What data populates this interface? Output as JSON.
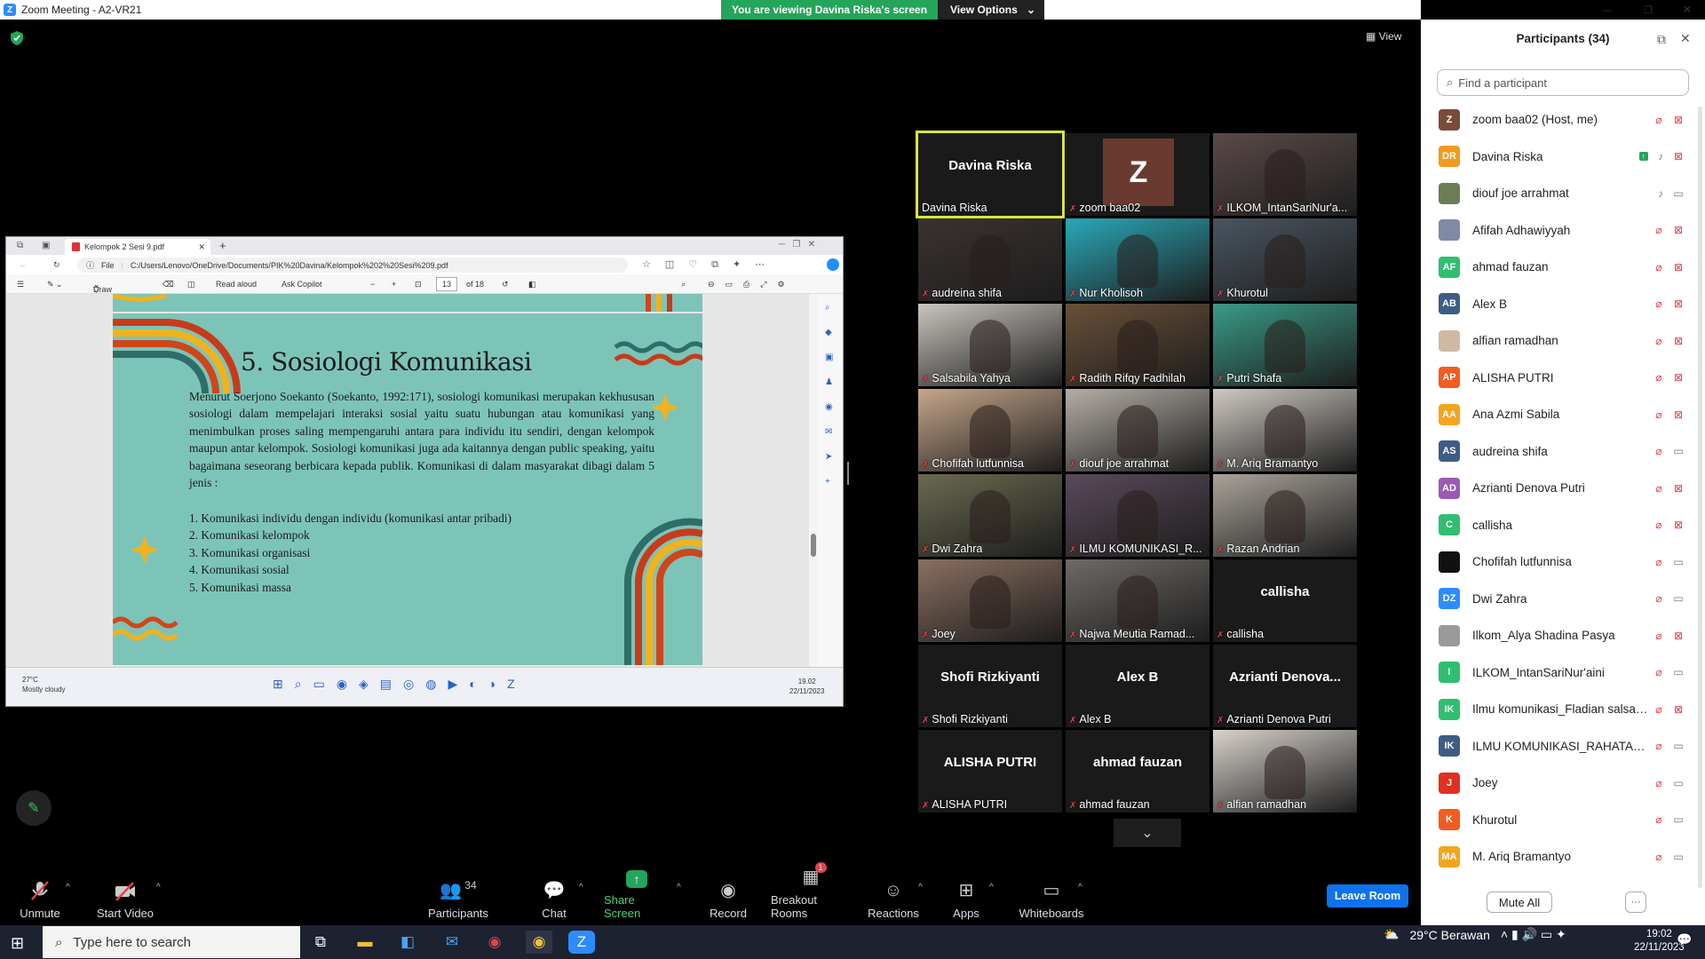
{
  "window": {
    "title": "Zoom Meeting - A2-VR21",
    "minimize": "─",
    "maximize": "❐",
    "close": "✕"
  },
  "banner": {
    "viewing_text": "You are viewing Davina Riska's screen",
    "view_options": "View Options"
  },
  "view_button": "View",
  "shared_screen": {
    "tab_title": "Kelompok 2 Sesi 9.pdf",
    "file_label": "File",
    "url": "C:/Users/Lenovo/OneDrive/Documents/PIK%20Davina/Kelompok%202%20Sesi%209.pdf",
    "toolbar": {
      "draw": "Draw",
      "read_aloud": "Read aloud",
      "ask_copilot": "Ask Copilot",
      "page": "13",
      "of_pages": "of 18"
    },
    "slide": {
      "title": "5. Sosiologi Komunikasi",
      "body": "Menurut Soerjono Soekanto (Soekanto, 1992:171), sosiologi komunikasi merupakan kekhususan sosiologi dalam mempelajari interaksi sosial yaitu suatu hubungan atau komunikasi yang menimbulkan proses saling mempengaruhi antara para individu itu sendiri, dengan kelompok maupun antar kelompok. Sosiologi komunikasi juga ada kaitannya dengan public speaking, yaitu bagaimana seseorang berbicara kepada publik. Komunikasi di dalam masyarakat dibagi dalam 5 jenis :",
      "list": [
        "1. Komunikasi individu dengan individu (komunikasi antar pribadi)",
        "2. Komunikasi kelompok",
        "3. Komunikasi organisasi",
        "4. Komunikasi sosial",
        "5. Komunikasi massa"
      ]
    },
    "inner_taskbar": {
      "weather_temp": "27°C",
      "weather_desc": "Mostly cloudy",
      "time": "19.02",
      "date": "22/11/2023"
    }
  },
  "video_tiles": [
    {
      "name": "Davina Riska",
      "big": "Davina Riska",
      "kind": "text",
      "active": true
    },
    {
      "name": "zoom baa02",
      "big": "Z",
      "kind": "avatar"
    },
    {
      "name": "ILKOM_IntanSariNur'a...",
      "kind": "video",
      "color": "#5a4a48"
    },
    {
      "name": "audreina shifa",
      "kind": "video",
      "color": "#3a3230"
    },
    {
      "name": "Nur Kholisoh",
      "kind": "video",
      "color": "#2aa8b8"
    },
    {
      "name": "Khurotul",
      "kind": "video",
      "color": "#4a5560"
    },
    {
      "name": "Salsabila Yahya",
      "kind": "video",
      "color": "#c9c4bd"
    },
    {
      "name": "Radith Rifqy Fadhilah",
      "kind": "video",
      "color": "#6a5038"
    },
    {
      "name": "Putri Shafa",
      "kind": "video",
      "color": "#3a9a86"
    },
    {
      "name": "Chofifah lutfunnisa",
      "kind": "video",
      "color": "#c6a68a"
    },
    {
      "name": "diouf joe arrahmat",
      "kind": "video",
      "color": "#b5aea6"
    },
    {
      "name": "M. Ariq Bramantyo",
      "kind": "video",
      "color": "#cfc9c2"
    },
    {
      "name": "Dwi Zahra",
      "kind": "video",
      "color": "#6a6a50"
    },
    {
      "name": "ILMU KOMUNIKASI_R...",
      "kind": "video",
      "color": "#5a4a5a"
    },
    {
      "name": "Razan Andrian",
      "kind": "video",
      "color": "#a9a39a"
    },
    {
      "name": "Joey",
      "kind": "video",
      "color": "#8a7060"
    },
    {
      "name": "Najwa Meutia Ramad...",
      "kind": "video",
      "color": "#6e6a66"
    },
    {
      "name": "callisha",
      "big": "callisha",
      "kind": "text"
    },
    {
      "name": "Shofi Rizkiyanti",
      "big": "Shofi Rizkiyanti",
      "kind": "text"
    },
    {
      "name": "Alex B",
      "big": "Alex B",
      "kind": "text"
    },
    {
      "name": "Azrianti Denova Putri",
      "big": "Azrianti  Denova...",
      "kind": "text"
    },
    {
      "name": "ALISHA PUTRI",
      "big": "ALISHA PUTRI",
      "kind": "text"
    },
    {
      "name": "ahmad fauzan",
      "big": "ahmad fauzan",
      "kind": "text"
    },
    {
      "name": "alfian ramadhan",
      "kind": "video",
      "color": "#d8d2cc"
    }
  ],
  "participants_panel": {
    "title": "Participants (34)",
    "search_placeholder": "Find a participant",
    "mute_all": "Mute All",
    "more": "···",
    "list": [
      {
        "initials": "Z",
        "color": "#7b4b3a",
        "name": "zoom baa02 (Host, me)",
        "mic": "muted",
        "video": "off"
      },
      {
        "initials": "DR",
        "color": "#f29a1f",
        "name": "Davina Riska",
        "mic": "on",
        "video": "off",
        "sharing": true
      },
      {
        "initials": "",
        "color": "#6b7d55",
        "name": "diouf joe arrahmat",
        "mic": "on",
        "video": "on"
      },
      {
        "initials": "",
        "color": "#7e8aa6",
        "name": "Afifah Adhawiyyah",
        "mic": "muted",
        "video": "off"
      },
      {
        "initials": "AF",
        "color": "#2fbf71",
        "name": "ahmad fauzan",
        "mic": "muted",
        "video": "off"
      },
      {
        "initials": "AB",
        "color": "#3e5c85",
        "name": "Alex B",
        "mic": "muted",
        "video": "off"
      },
      {
        "initials": "",
        "color": "#d0b9a4",
        "name": "alfian ramadhan",
        "mic": "muted",
        "video": "off"
      },
      {
        "initials": "AP",
        "color": "#f25c1f",
        "name": "ALISHA PUTRI",
        "mic": "muted",
        "video": "off"
      },
      {
        "initials": "AA",
        "color": "#f2a51f",
        "name": "Ana Azmi Sabila",
        "mic": "muted",
        "video": "off"
      },
      {
        "initials": "AS",
        "color": "#3e5c85",
        "name": "audreina shifa",
        "mic": "muted",
        "video": "on"
      },
      {
        "initials": "AD",
        "color": "#9b59b6",
        "name": "Azrianti Denova Putri",
        "mic": "muted",
        "video": "off"
      },
      {
        "initials": "C",
        "color": "#2fbf71",
        "name": "callisha",
        "mic": "muted",
        "video": "off"
      },
      {
        "initials": "",
        "color": "#111111",
        "name": "Chofifah lutfunnisa",
        "mic": "muted",
        "video": "on"
      },
      {
        "initials": "DZ",
        "color": "#2d8cff",
        "name": "Dwi Zahra",
        "mic": "muted",
        "video": "on"
      },
      {
        "initials": "",
        "color": "#9a9a9a",
        "name": "Ilkom_Alya Shadina Pasya",
        "mic": "muted",
        "video": "off"
      },
      {
        "initials": "I",
        "color": "#2fbf71",
        "name": "ILKOM_IntanSariNur'aini",
        "mic": "muted",
        "video": "on"
      },
      {
        "initials": "IK",
        "color": "#2fbf71",
        "name": "Ilmu komunikasi_Fladian salsabi...",
        "mic": "muted",
        "video": "off"
      },
      {
        "initials": "IK",
        "color": "#3e5c85",
        "name": "ILMU KOMUNIKASI_RAHATAMA...",
        "mic": "muted",
        "video": "on"
      },
      {
        "initials": "J",
        "color": "#e0301e",
        "name": "Joey",
        "mic": "muted",
        "video": "on"
      },
      {
        "initials": "K",
        "color": "#f25c1f",
        "name": "Khurotul",
        "mic": "muted",
        "video": "on"
      },
      {
        "initials": "MA",
        "color": "#f2a51f",
        "name": "M. Ariq Bramantyo",
        "mic": "muted",
        "video": "on"
      }
    ]
  },
  "zoom_toolbar": {
    "unmute": "Unmute",
    "start_video": "Start Video",
    "participants_count": "34",
    "participants": "Participants",
    "chat": "Chat",
    "share_screen": "Share Screen",
    "record": "Record",
    "breakout": "Breakout Rooms",
    "breakout_badge": "1",
    "reactions": "Reactions",
    "apps": "Apps",
    "whiteboards": "Whiteboards",
    "leave": "Leave Room"
  },
  "taskbar": {
    "search_placeholder": "Type here to search",
    "weather": "29°C  Berawan",
    "time": "19:02",
    "date": "22/11/2023"
  }
}
